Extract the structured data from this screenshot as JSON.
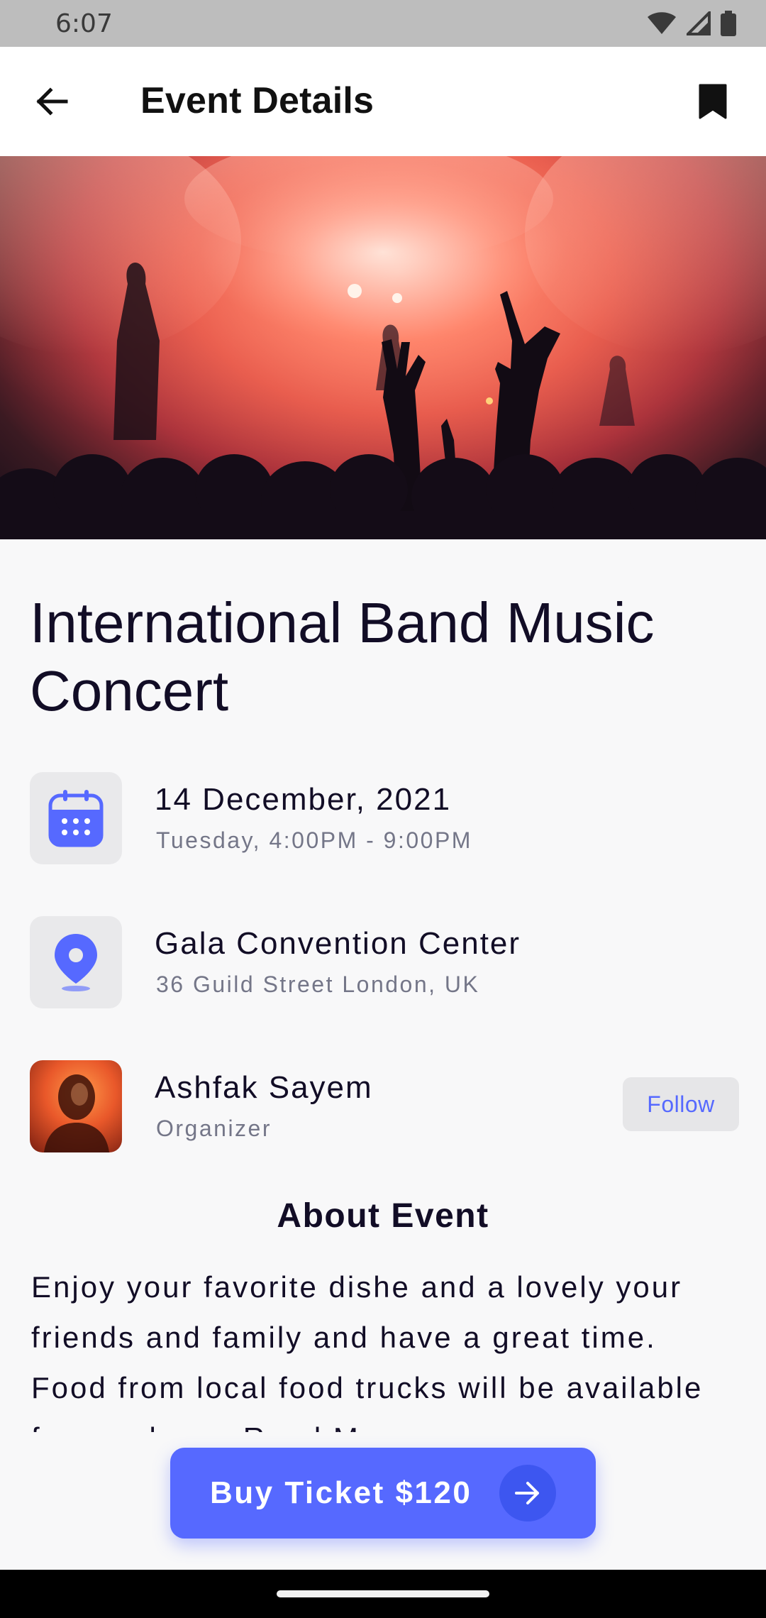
{
  "status_bar": {
    "time": "6:07",
    "icons": [
      "wifi-icon",
      "signal-icon",
      "battery-icon"
    ]
  },
  "app_bar": {
    "title": "Event Details",
    "back_icon": "arrow-left-icon",
    "bookmark_icon": "bookmark-icon"
  },
  "event": {
    "title": "International Band Music Concert",
    "date": {
      "main": "14 December, 2021",
      "sub": "Tuesday, 4:00PM - 9:00PM",
      "icon": "calendar-icon"
    },
    "location": {
      "main": "Gala Convention Center",
      "sub": "36 Guild Street London, UK",
      "icon": "location-pin-icon"
    },
    "organizer": {
      "name": "Ashfak Sayem",
      "role": "Organizer",
      "follow_label": "Follow"
    },
    "about": {
      "title": "About Event",
      "body": "Enjoy your favorite dishe and a lovely your friends and family and have a great time. Food from local food trucks will be available for purchase. Read More..."
    },
    "buy": {
      "label": "Buy Ticket $120",
      "icon": "arrow-right-icon"
    }
  },
  "colors": {
    "accent": "#5669ff",
    "title_text": "#120d26",
    "secondary_text": "#747688",
    "tile_bg": "#e9e9eb"
  }
}
